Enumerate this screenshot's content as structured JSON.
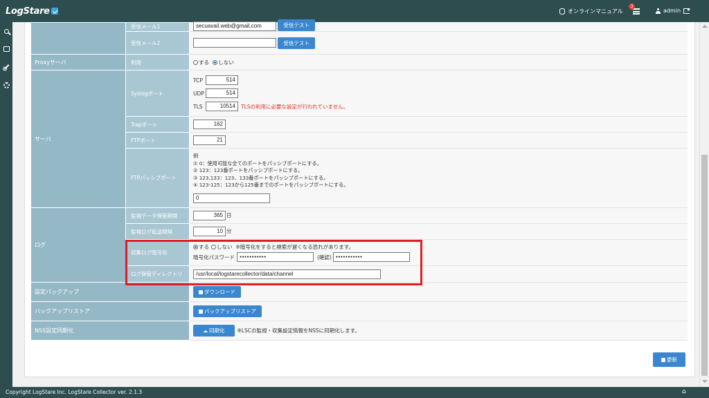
{
  "header": {
    "logo": "LogStare",
    "manual_label": "オンラインマニュアル",
    "notification_count": "3",
    "user_name": "admin"
  },
  "sidebar": {
    "icons": [
      "search-icon",
      "book-icon",
      "wrench-icon",
      "gears-icon"
    ]
  },
  "form": {
    "mail": {
      "recv1_label": "受信メール1",
      "recv1_value": "secuavail.web@gmail.com",
      "recv2_label": "受信メール2",
      "recv2_value": "",
      "test_button": "受信テスト"
    },
    "proxy": {
      "section": "Proxyサーバ",
      "use_label": "利用",
      "opt_yes": "する",
      "opt_no": "しない",
      "selected": "しない"
    },
    "server": {
      "section": "サーバ",
      "syslog_label": "Syslogポート",
      "tcp_label": "TCP",
      "tcp_value": "514",
      "udp_label": "UDP",
      "udp_value": "514",
      "tls_label": "TLS",
      "tls_value": "10514",
      "tls_warning": "TLSの利用に必要な設定が行われていません。",
      "trap_label": "Trapポート",
      "trap_value": "162",
      "ftp_label": "FTPポート",
      "ftp_value": "21",
      "passive_label": "FTPパッシブポート",
      "passive_examples": [
        "例",
        "① 0：使用可能な全てのポートをパッシブポートにする。",
        "② 123：123番ポートをパッシブポートにする。",
        "③ 123,133：123、133番ポートをパッシブポートにする。",
        "④ 123-125：123から125番までのポートをパッシブポートにする。"
      ],
      "passive_value": "0"
    },
    "log": {
      "section": "ログ",
      "retention_label": "監視データ保管期間",
      "retention_value": "365",
      "retention_unit": "日",
      "transfer_label": "監視ログ転送間隔",
      "transfer_value": "10",
      "transfer_unit": "分",
      "encrypt_label": "収集ログ暗号化",
      "encrypt_yes": "する",
      "encrypt_no": "しない",
      "encrypt_selected": "する",
      "encrypt_note": "※暗号化をすると検索が遅くなる恐れがあります。",
      "password_label": "暗号化パスワード",
      "password_mask": "●●●●●●●●●●●",
      "confirm_label": "(確認)",
      "confirm_mask": "●●●●●●●●●●●",
      "dir_label": "ログ保管ディレクトリ",
      "dir_value": "/usr/local/logstarecollector/data/channel"
    },
    "backup": {
      "section": "設定バックアップ",
      "button": "ダウンロード"
    },
    "restore": {
      "section": "バックアップリストア",
      "button": "バックアップリストア"
    },
    "nss": {
      "section": "NSS設定同期化",
      "button": "同期化",
      "note": "※LSCの監視・収集設定情報をNSSに同期化します。"
    },
    "update_button": "更新"
  },
  "footer": {
    "copyright": "Copyright LogStare Inc. LogStare Collector ver. 2.1.3"
  },
  "colors": {
    "nav": "#2d4d4e",
    "label_dark": "#95b8c7",
    "label_light": "#a9c6d3",
    "button": "#3a87cf",
    "highlight": "#e21c24"
  }
}
